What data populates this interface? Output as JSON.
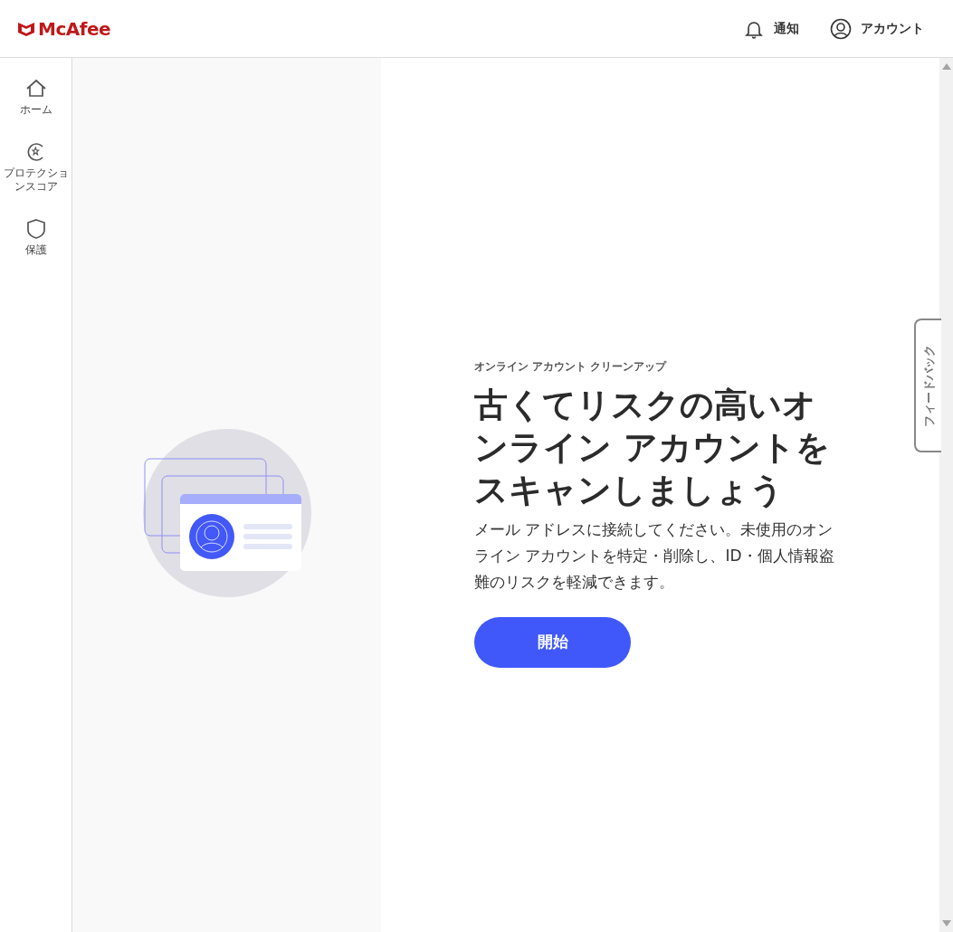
{
  "header": {
    "logo": "McAfee",
    "notifications": "通知",
    "account": "アカウント"
  },
  "sidebar": {
    "items": [
      {
        "kind": "home",
        "label": "ホーム",
        "selected": false
      },
      {
        "kind": "score",
        "label": "プロテクションスコア",
        "selected": false
      },
      {
        "kind": "shield",
        "label": "保護",
        "selected": false
      }
    ]
  },
  "main": {
    "eyebrow": "オンライン アカウント クリーンアップ",
    "title": "古くてリスクの高いオンライン アカウントをスキャンしましょう",
    "description": "メール アドレスに接続してください。未使用のオンライン アカウントを特定・削除し、ID・個人情報盗難のリスクを軽減できます。",
    "button": "開始"
  },
  "feedback_tab": "フィードバック"
}
